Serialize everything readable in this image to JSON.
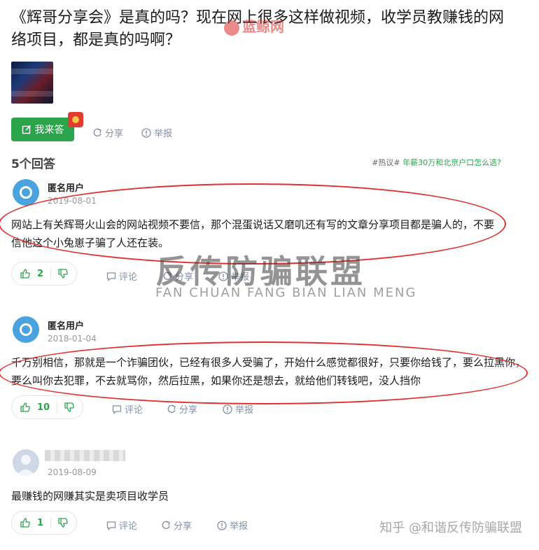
{
  "question": {
    "title": "《辉哥分享会》是真的吗？现在网上很多这样做视频，收学员教赚钱的网络项目，都是真的吗啊？",
    "stamp_text": "蓝鲸网"
  },
  "actions": {
    "answer_label": "我来答",
    "share_label": "分享",
    "report_label": "举报"
  },
  "answers_header": {
    "count_label": "5个回答",
    "hot_tag": "#热议#",
    "hot_link": "年薪30万和北京户口怎么选?"
  },
  "answers": [
    {
      "user": "匿名用户",
      "date": "2019-08-01",
      "text": "网站上有关辉哥火山会的网站视频不要信，那个混蛋说话又磨叽还有写的文章分享项目都是骗人的，不要信他这个小兔崽子骗了人还在装。",
      "upvotes": "2",
      "comment_label": "评论",
      "share_label": "分享",
      "report_label": "举报"
    },
    {
      "user": "匿名用户",
      "date": "2018-01-04",
      "text": "千万别相信，那就是一个诈骗团伙，已经有很多人受骗了，开始什么感觉都很好，只要你给钱了，要么拉黑你，要么叫你去犯罪，不去就骂你，然后拉黑，如果你还是想去，就给他们转钱吧，没人挡你",
      "upvotes": "10",
      "comment_label": "评论",
      "share_label": "分享",
      "report_label": "举报"
    },
    {
      "user": "",
      "date": "2019-08-09",
      "text": "最赚钱的网赚其实是卖项目收学员",
      "upvotes": "1",
      "comment_label": "评论",
      "share_label": "分享",
      "report_label": "举报"
    }
  ],
  "watermarks": {
    "center_cn": "反传防骗联盟",
    "center_en": "FAN CHUAN FANG BIAN LIAN MENG",
    "footer": "知乎 @和谐反传防骗联盟"
  },
  "colors": {
    "accent_green": "#2ba44c",
    "annotation_red": "#e23030",
    "muted": "#8590a6"
  }
}
